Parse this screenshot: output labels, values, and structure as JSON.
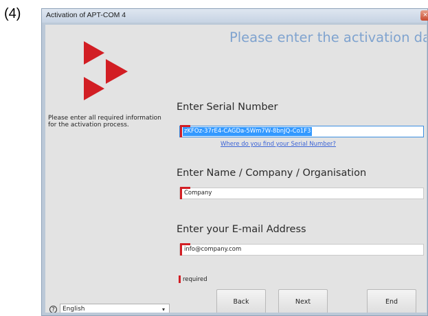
{
  "page": {
    "step_label": "(4)"
  },
  "window": {
    "title": "Activation of APT-COM 4",
    "close_glyph": "×"
  },
  "header": {
    "text": "Please enter the activation data"
  },
  "sidebar": {
    "info_text": "Please enter all required information for the activation process."
  },
  "serial": {
    "label": "Enter Serial Number",
    "value": "zKFOz-37rE4-CAGDa-5Wm7W-8bnJQ-Co1F3",
    "help_link": "Where do you find your Serial Number?"
  },
  "name": {
    "label": "Enter Name / Company / Organisation",
    "value": "Company"
  },
  "email": {
    "label": "Enter your E-mail Address",
    "value": "info@company.com"
  },
  "required": {
    "text": "required"
  },
  "buttons": {
    "back": "Back",
    "next": "Next",
    "end": "End"
  },
  "language": {
    "help_glyph": "?",
    "selected": "English",
    "caret": "▾"
  },
  "colors": {
    "accent_red": "#d21e24",
    "header_blue": "#7fa3cf",
    "link_blue": "#3a63d6",
    "selection_blue": "#3399ff"
  },
  "icons": {
    "logo": "red-triangles-logo",
    "help": "help-icon",
    "close": "close-icon",
    "dropdown": "chevron-down-icon"
  }
}
